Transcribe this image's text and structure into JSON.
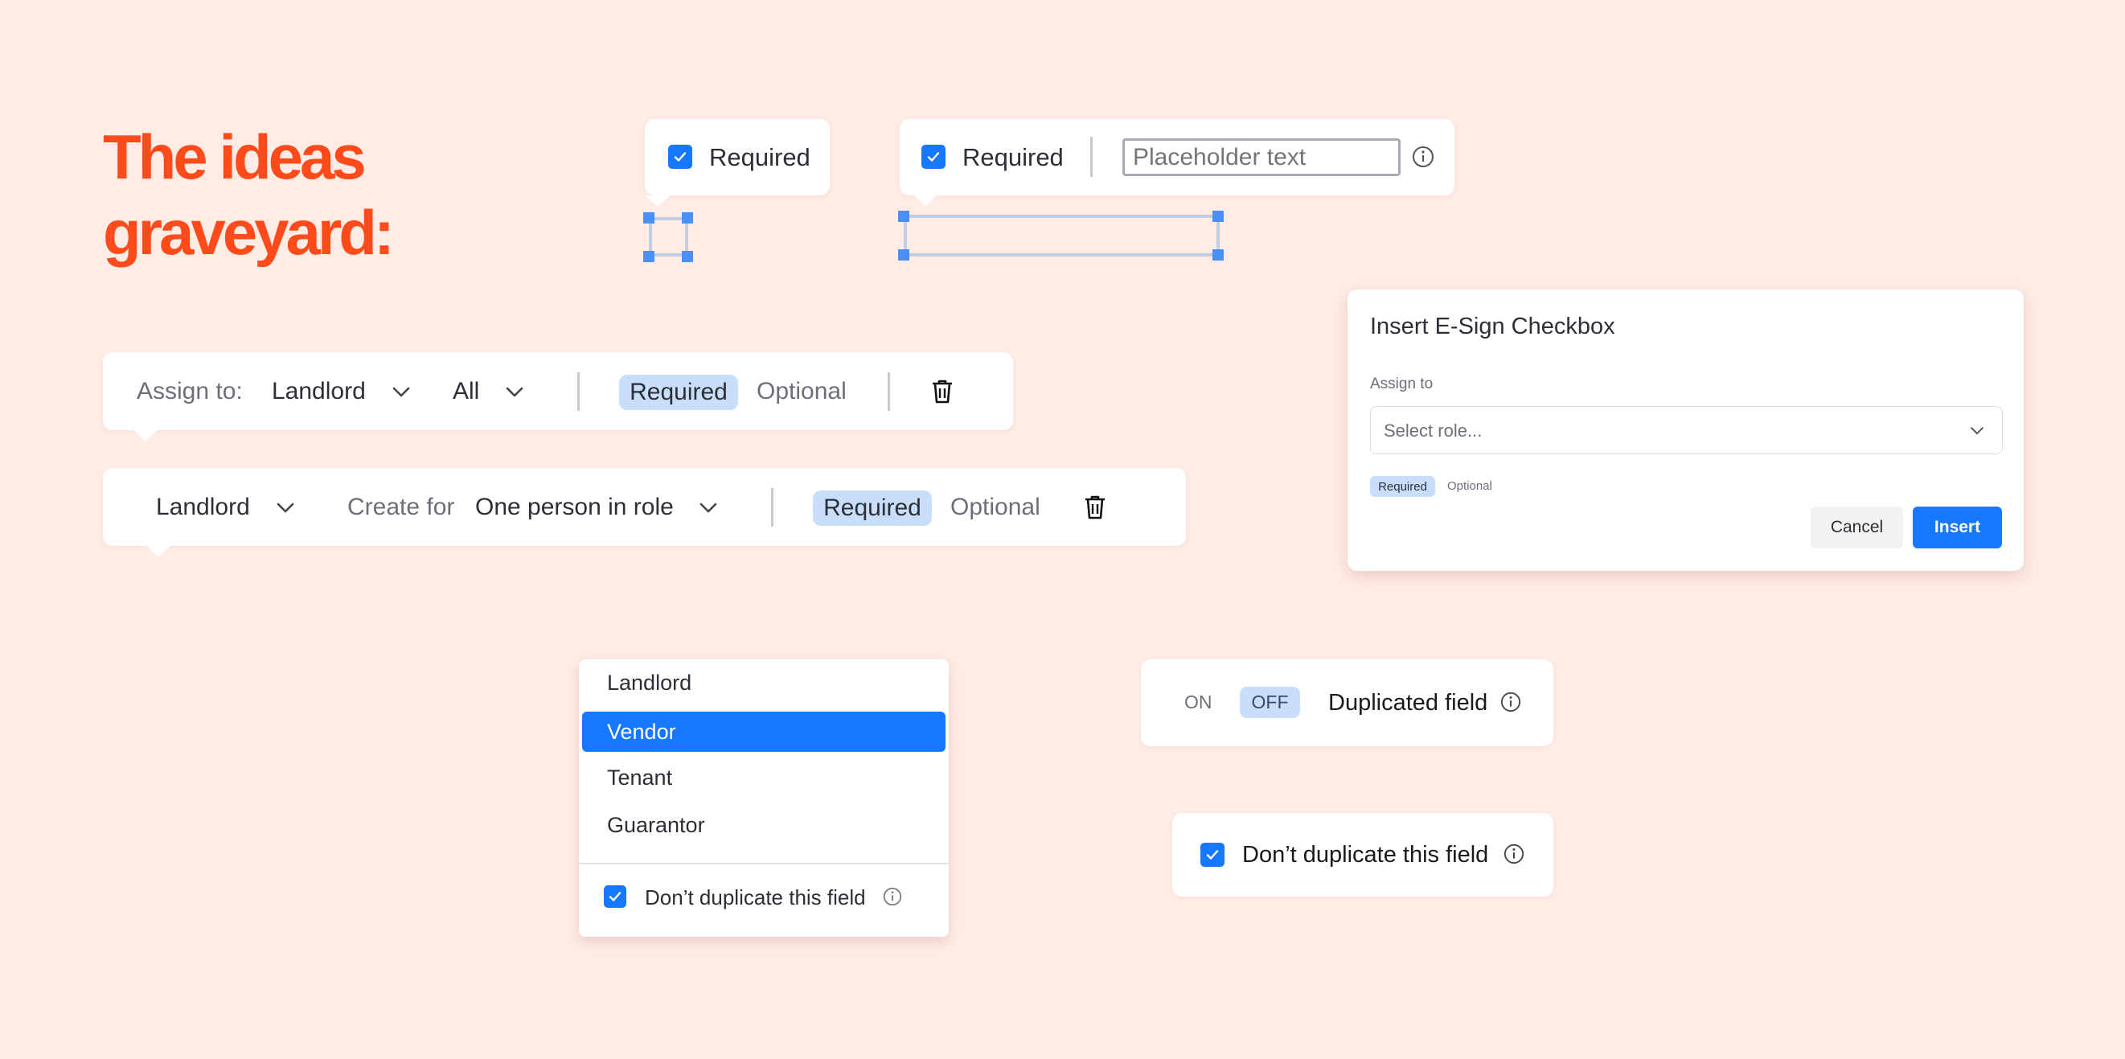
{
  "page": {
    "title_line1": "The ideas",
    "title_line2": "graveyard:"
  },
  "colors": {
    "background": "#ffece5",
    "title": "#ff4a1c",
    "accent_blue": "#1677ff",
    "pill_blue": "#c9defa",
    "card": "#ffffff"
  },
  "required_checkbox_popover": {
    "checkbox_checked": true,
    "label": "Required"
  },
  "required_text_popover": {
    "checkbox_checked": true,
    "label": "Required",
    "input_placeholder": "Placeholder text",
    "icon": "info-icon"
  },
  "assign_toolbar": {
    "assign_label": "Assign to:",
    "role_value": "Landlord",
    "scope_value": "All",
    "required_label": "Required",
    "optional_label": "Optional",
    "selected": "Required",
    "delete_icon": "trash-icon"
  },
  "create_toolbar": {
    "role_value": "Landlord",
    "create_label": "Create for",
    "create_value": "One person in role",
    "required_label": "Required",
    "optional_label": "Optional",
    "selected": "Required",
    "delete_icon": "trash-icon"
  },
  "dialog": {
    "title": "Insert E-Sign Checkbox",
    "assign_label": "Assign to",
    "select_placeholder": "Select role...",
    "required_label": "Required",
    "optional_label": "Optional",
    "cancel_label": "Cancel",
    "insert_label": "Insert"
  },
  "role_menu": {
    "items": [
      "Landlord",
      "Vendor",
      "Tenant",
      "Guarantor"
    ],
    "selected": "Vendor",
    "dont_duplicate_label": "Don’t duplicate this field",
    "dont_duplicate_checked": true
  },
  "duplicate_toggle": {
    "on_label": "ON",
    "off_label": "OFF",
    "selected": "OFF",
    "label": "Duplicated field"
  },
  "dont_duplicate_card": {
    "checked": true,
    "label": "Don’t duplicate this field"
  }
}
